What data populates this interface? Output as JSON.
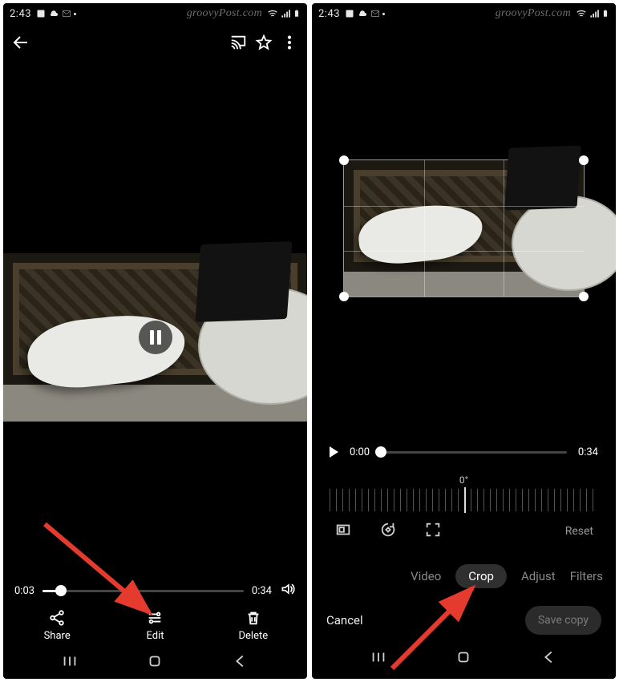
{
  "watermark": "groovyPost.com",
  "status": {
    "time": "2:43"
  },
  "left": {
    "scrub": {
      "current": "0:03",
      "total": "0:34",
      "progress_pct": 9
    },
    "actions": {
      "share": "Share",
      "edit": "Edit",
      "delete": "Delete"
    }
  },
  "right": {
    "scrub": {
      "current": "0:00",
      "total": "0:34",
      "progress_pct": 0
    },
    "rotation_label": "0°",
    "reset_label": "Reset",
    "tabs": {
      "video": "Video",
      "crop": "Crop",
      "adjust": "Adjust",
      "filters": "Filters"
    },
    "dialog": {
      "cancel": "Cancel",
      "save": "Save copy"
    }
  }
}
